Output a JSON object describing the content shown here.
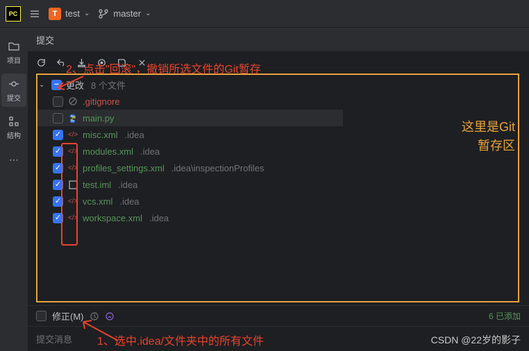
{
  "titlebar": {
    "logo": "PC",
    "project_name": "test",
    "project_letter": "T",
    "branch_name": "master"
  },
  "sidebar": {
    "items": [
      {
        "label": "项目",
        "icon": "folder"
      },
      {
        "label": "提交",
        "icon": "commit"
      },
      {
        "label": "结构",
        "icon": "structure"
      }
    ]
  },
  "panel": {
    "title": "提交"
  },
  "changes": {
    "header_label": "更改",
    "file_count": "8 个文件",
    "files": [
      {
        "name": ".gitignore",
        "icon": "ignore",
        "checked": false,
        "dir": "",
        "unversioned": true
      },
      {
        "name": "main.py",
        "icon": "python",
        "checked": false,
        "dir": "",
        "unversioned": false,
        "selected": true
      },
      {
        "name": "misc.xml",
        "icon": "xml",
        "checked": true,
        "dir": ".idea"
      },
      {
        "name": "modules.xml",
        "icon": "xml",
        "checked": true,
        "dir": ".idea"
      },
      {
        "name": "profiles_settings.xml",
        "icon": "xml",
        "checked": true,
        "dir": ".idea\\inspectionProfiles"
      },
      {
        "name": "test.iml",
        "icon": "iml",
        "checked": true,
        "dir": ".idea"
      },
      {
        "name": "vcs.xml",
        "icon": "xml",
        "checked": true,
        "dir": ".idea"
      },
      {
        "name": "workspace.xml",
        "icon": "xml",
        "checked": true,
        "dir": ".idea"
      }
    ]
  },
  "amend": {
    "label": "修正(M)",
    "status": "6 已添加"
  },
  "commit_msg": {
    "placeholder": "提交消息"
  },
  "annotations": {
    "top": "2、点击\"回滚\"，撤销所选文件的Git暂存",
    "right1": "这里是Git",
    "right2": "暂存区",
    "bottom": "1、选中.idea/文件夹中的所有文件"
  },
  "watermark": "CSDN @22岁的影子"
}
